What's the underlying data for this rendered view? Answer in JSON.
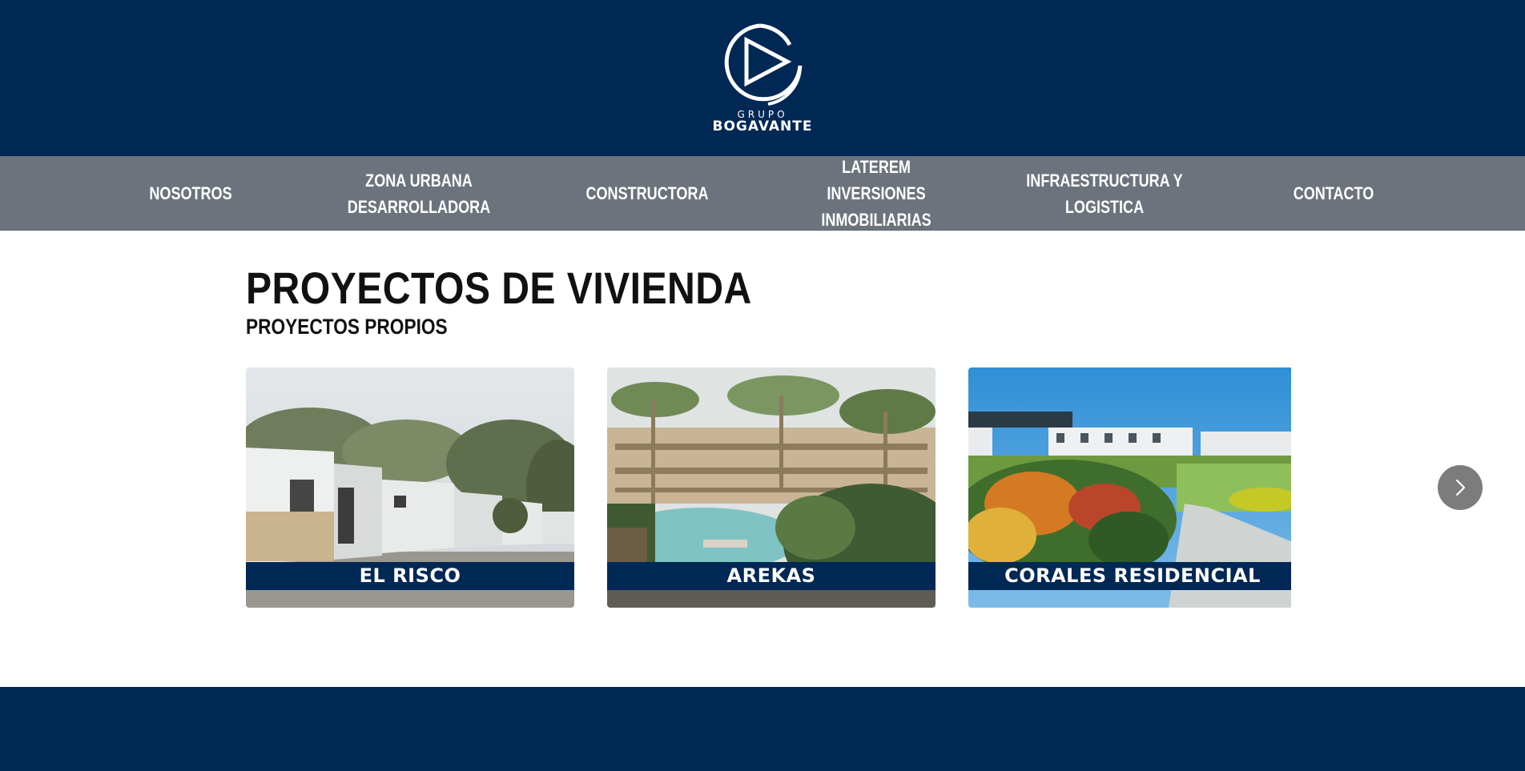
{
  "brand": {
    "logo_line1": "GRUPO",
    "logo_line2": "BOGAVANTE"
  },
  "nav": {
    "items": [
      {
        "label": "NOSOTROS"
      },
      {
        "label": "ZONA URBANA\nDESARROLLADORA"
      },
      {
        "label": "CONSTRUCTORA"
      },
      {
        "label": "LATEREM INVERSIONES\nINMOBILIARIAS"
      },
      {
        "label": "INFRAESTRUCTURA Y\nLOGISTICA"
      },
      {
        "label": "CONTACTO"
      }
    ]
  },
  "main": {
    "title": "PROYECTOS DE VIVIENDA",
    "subtitle": "PROYECTOS PROPIOS",
    "projects": [
      {
        "name": "EL RISCO"
      },
      {
        "name": "AREKAS"
      },
      {
        "name": "CORALES RESIDENCIAL"
      }
    ]
  },
  "colors": {
    "header_bg": "#002855",
    "nav_bg": "#6c737c",
    "label_bg": "#002855",
    "arrow_bg": "#7c7c7c"
  },
  "icons": {
    "logo": "play-triangle-in-ring",
    "carousel_next": "chevron-right-icon"
  }
}
